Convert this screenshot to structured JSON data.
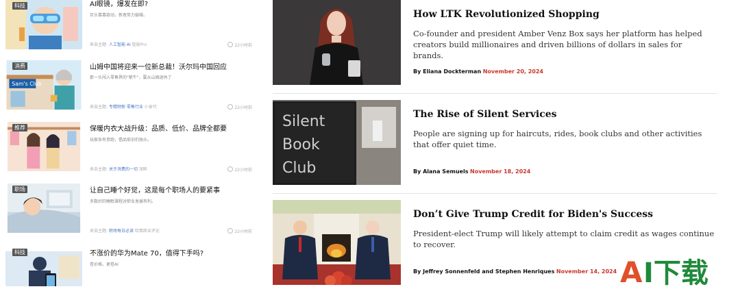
{
  "feed": {
    "items": [
      {
        "tag": "科技",
        "title": "AI眼镜，爆发在即?",
        "summary": "巨头靠靠欲动，新者势力鼓噪。",
        "meta_prefix": "来自主题:",
        "topic": "人工智能·AI",
        "topic2": "智能Pro",
        "time": "22小时前"
      },
      {
        "tag": "消费",
        "title": "山姆中国将迎来一位新总裁！沃尔玛中国回应",
        "summary": "那一头闯入零售界的\"紫牛\"，要从山姆退休了",
        "meta_prefix": "来自主题:",
        "topic": "专精特新·零售行业",
        "topic2": "小食代",
        "time": "22小时前"
      },
      {
        "tag": "推荐",
        "title": "保暖内衣大战升级：品质、低价、品牌全都要",
        "summary": "玩家各有意跑，倡品依旧仍独头。",
        "meta_prefix": "来自主题:",
        "topic": "关于消费的一切",
        "topic2": "深眸",
        "time": "22小时前"
      },
      {
        "tag": "职场",
        "title": "让自己睡个好觉，这是每个职场人的要紧事",
        "summary": "多数好的睡眠课程对职业发展有利。",
        "meta_prefix": "来自主题:",
        "topic": "职场每日必读",
        "topic2": "哈佛商业评论",
        "time": "22小时前"
      },
      {
        "tag": "科技",
        "title": "不涨价的华为Mate 70，值得下手吗?",
        "summary": "卷价格，更卷AI",
        "meta_prefix": "",
        "topic": "",
        "topic2": "",
        "time": ""
      }
    ]
  },
  "articles": [
    {
      "title": "How LTK Revolutionized Shopping",
      "description": "Co-founder and president Amber Venz Box says her platform has helped creators build millionaires and driven billions of dollars in sales for brands.",
      "byline": "By Eliana Dockterman",
      "date": "November 20, 2024"
    },
    {
      "title": "The Rise of Silent Services",
      "description": "People are signing up for haircuts, rides, book clubs and other activities that offer quiet time.",
      "byline": "By Alana Semuels",
      "date": "November 18, 2024"
    },
    {
      "title": "Don’t Give Trump Credit for Biden's Success",
      "description": "President-elect Trump will likely attempt to claim credit as wages continue to recover.",
      "byline": "By Jeffrey Sonnenfeld and Stephen Henriques",
      "date": "November 14, 2024"
    }
  ],
  "chalkboard_text": [
    "Silent",
    "Book",
    "Club"
  ],
  "storefront_sign": "Sam's Club",
  "watermark": {
    "text_a": "A",
    "text_rest": "I下载",
    "color_a": "#e0502a",
    "color_rest": "#1f8a3a"
  },
  "colors": {
    "date_red": "#c8372d",
    "topic_blue": "#4a78c4",
    "tag_bg": "#555555"
  }
}
